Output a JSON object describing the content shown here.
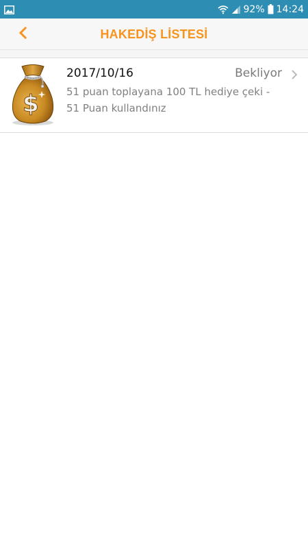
{
  "status_bar": {
    "battery": "92%",
    "time": "14:24",
    "left_icon": "image-icon",
    "icons": [
      "wifi-icon",
      "signal-icon",
      "battery-icon"
    ]
  },
  "app_bar": {
    "title": "HAKEDİŞ LİSTESİ",
    "back_icon": "chevron-left-icon",
    "accent_color": "#f7941d"
  },
  "list": {
    "items": [
      {
        "icon": "money-bag-icon",
        "date": "2017/10/16",
        "status": "Bekliyor",
        "description": "51 puan toplayana 100 TL hediye çeki - 51 Puan kullandınız"
      }
    ]
  },
  "colors": {
    "status_bar": "#2e8db3",
    "app_bar_bg": "#f7f7f7",
    "divider": "#dcdcdc"
  }
}
